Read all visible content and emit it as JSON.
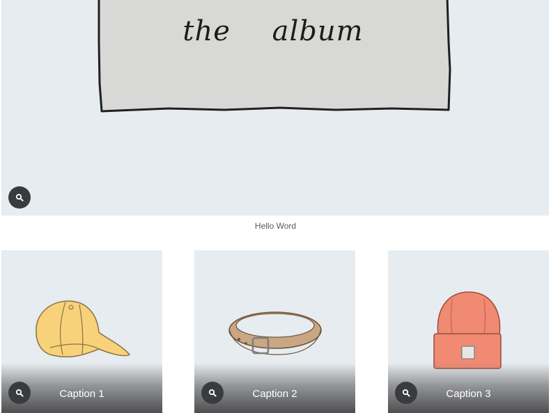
{
  "hero": {
    "image_text": "the album",
    "caption": "Hello Word",
    "zoom_icon": "search-icon"
  },
  "gallery": {
    "items": [
      {
        "caption": "Caption 1",
        "image": "cap-illustration",
        "zoom_icon": "search-icon"
      },
      {
        "caption": "Caption 2",
        "image": "belt-illustration",
        "zoom_icon": "search-icon"
      },
      {
        "caption": "Caption 3",
        "image": "beanie-illustration",
        "zoom_icon": "search-icon"
      }
    ]
  },
  "colors": {
    "image_background": "#e6ecf0",
    "zoom_button": "#3a3b3d",
    "caption_text": "#5a5a5a",
    "cap": "#f7d27a",
    "belt": "#c9a783",
    "beanie": "#f08a72"
  }
}
